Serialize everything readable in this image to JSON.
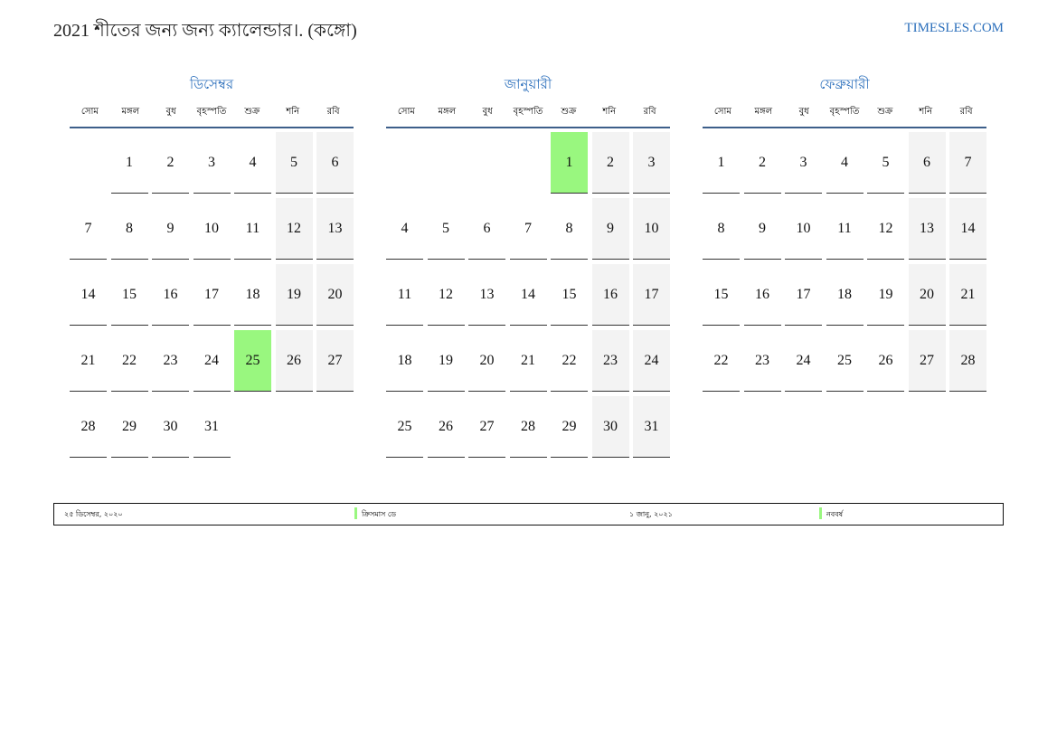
{
  "header": {
    "title": "2021 শীতের জন্য জন্য ক্যালেন্ডার।. (কঙ্গো)",
    "site": "TIMESLES.COM"
  },
  "weekdays": [
    "সোম",
    "মঙ্গল",
    "বুধ",
    "বৃহস্পতি",
    "শুক্র",
    "শনি",
    "রবি"
  ],
  "months": [
    {
      "name": "ডিসেম্বর",
      "start_weekday_index": 1,
      "days": 31,
      "holidays": [
        25
      ]
    },
    {
      "name": "জানুয়ারী",
      "start_weekday_index": 4,
      "days": 31,
      "holidays": [
        1
      ]
    },
    {
      "name": "ফেব্রুয়ারী",
      "start_weekday_index": 0,
      "days": 28,
      "holidays": []
    }
  ],
  "footer": [
    {
      "date": "২৫ ডিসেম্বর, ২০২০",
      "holiday": "ক্রিসমাস ডে"
    },
    {
      "date": "১ জানু, ২০২১",
      "holiday": "নববর্ষ"
    }
  ],
  "colors": {
    "accent": "#2a6ebb",
    "holiday": "#99f77f",
    "weekend": "#f3f3f3"
  }
}
